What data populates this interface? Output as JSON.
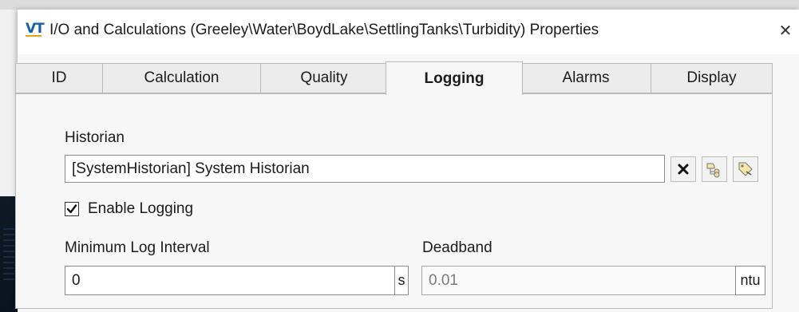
{
  "window": {
    "title": "I/O and Calculations (Greeley\\Water\\BoydLake\\SettlingTanks\\Turbidity) Properties",
    "icon": "vtscada-app-icon",
    "close_glyph": "✕"
  },
  "tabs": [
    {
      "label": "ID",
      "active": false
    },
    {
      "label": "Calculation",
      "active": false
    },
    {
      "label": "Quality",
      "active": false
    },
    {
      "label": "Logging",
      "active": true
    },
    {
      "label": "Alarms",
      "active": false
    },
    {
      "label": "Display",
      "active": false
    }
  ],
  "historian": {
    "label": "Historian",
    "value": "[SystemHistorian]   System Historian",
    "buttons": [
      "clear-icon",
      "tag-browser-icon",
      "tag-properties-icon"
    ]
  },
  "enable_logging": {
    "label": "Enable Logging",
    "checked": true
  },
  "min_log_interval": {
    "label": "Minimum Log Interval",
    "value": "0",
    "unit": "s"
  },
  "deadband": {
    "label": "Deadband",
    "value": "0.01",
    "unit": "ntu"
  }
}
